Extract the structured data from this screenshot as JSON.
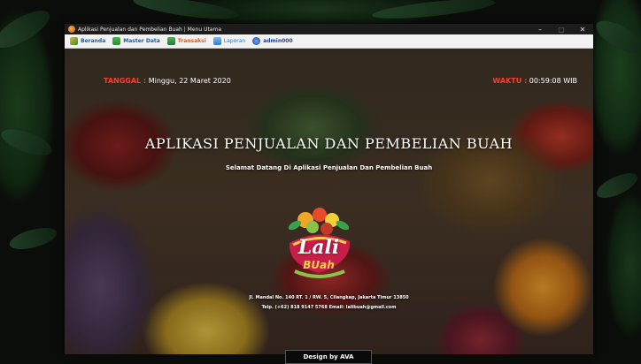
{
  "window": {
    "title": "Aplikasi Penjualan dan Pembelian Buah | Menu Utama",
    "controls": {
      "minimize": "–",
      "maximize": "▢",
      "close": "✕"
    }
  },
  "menu": {
    "items": [
      {
        "label": "Beranda",
        "icon": "home-icon",
        "color": "#2f8f2f"
      },
      {
        "label": "Master Data",
        "icon": "database-icon",
        "color": "#2f8f2f"
      },
      {
        "label": "Transaksi",
        "icon": "cart-icon",
        "color": "#e05a1c"
      },
      {
        "label": "Laporan",
        "icon": "report-icon",
        "color": "#2b7bd6"
      },
      {
        "label": "admin000",
        "icon": "user-icon",
        "color": "#1d3f9a"
      }
    ]
  },
  "header": {
    "date_label": "TANGGAL :",
    "date_value": "Minggu, 22 Maret 2020",
    "time_label": "WAKTU :",
    "time_value": "00:59:08 WIB"
  },
  "main": {
    "title": "APLIKASI PENJUALAN DAN PEMBELIAN BUAH",
    "welcome": "Selamat Datang Di Aplikasi Penjualan Dan Pembelian Buah",
    "logo_line1": "Lali",
    "logo_line2": "BUah",
    "address": "Jl. Mandal No. 140 RT. 1 / RW. 5, Cilangkap, Jakarta Timur 13850",
    "contact": "Telp. (+62) 818 9147 5768 Email: lalibuah@gmail.com"
  },
  "footer": {
    "credit": "Design by AVA"
  },
  "colors": {
    "accent_red": "#ff3b2f",
    "menubar": "#f2f2f2",
    "titlebar": "#1c1c1c"
  }
}
